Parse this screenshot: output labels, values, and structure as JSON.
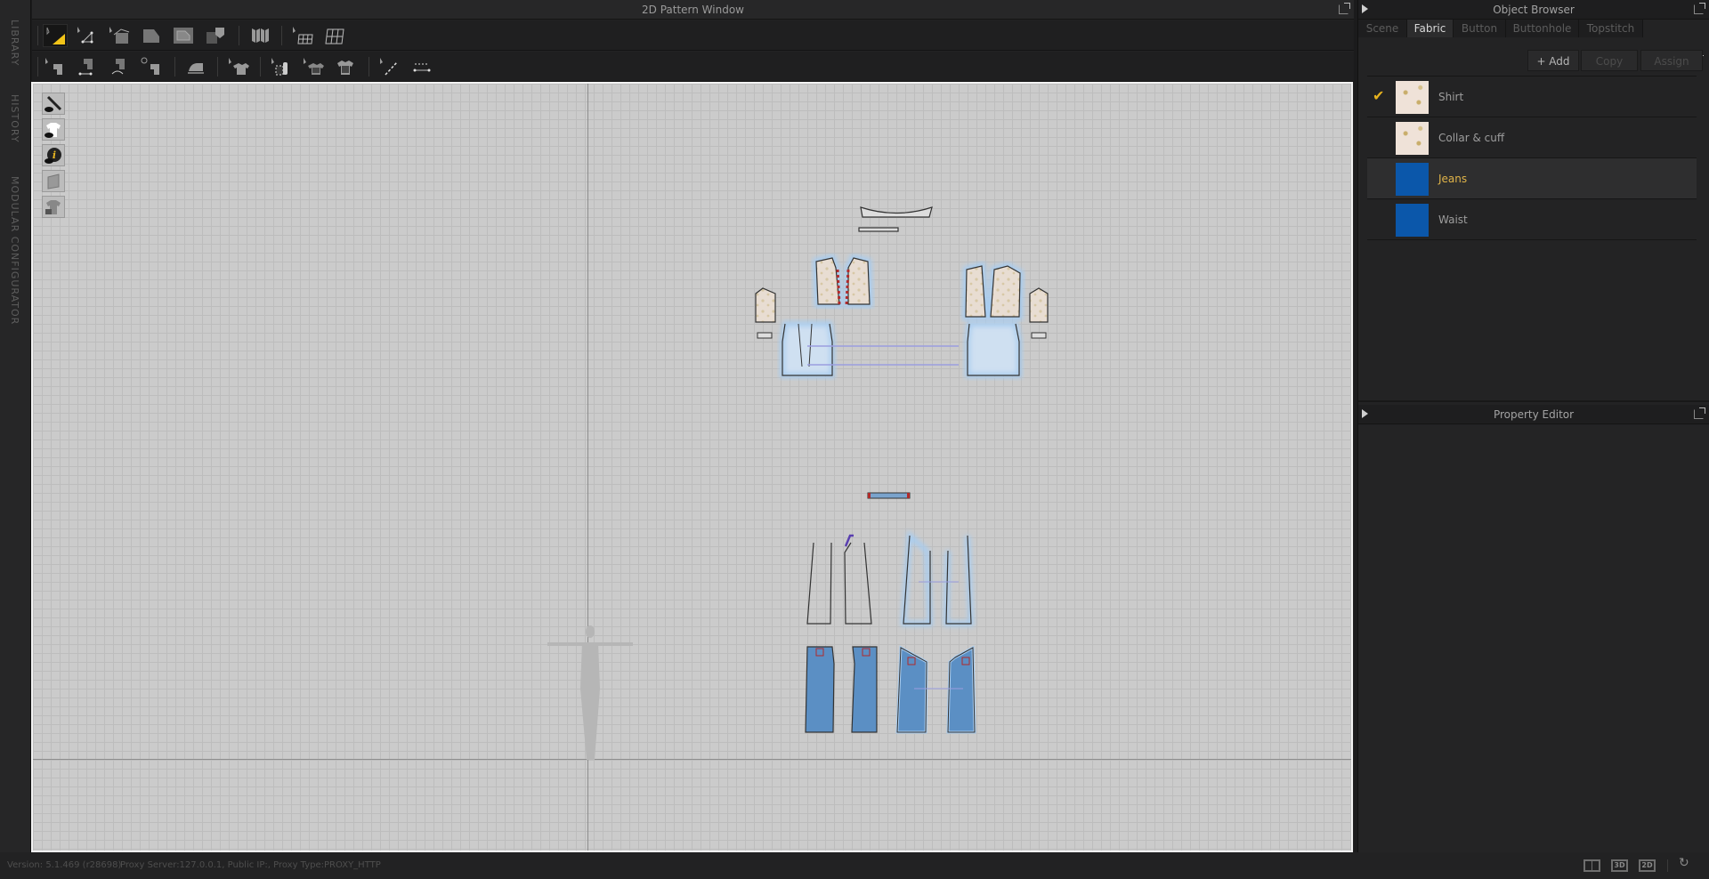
{
  "left_strip": {
    "tabs": [
      "LIBRARY",
      "HISTORY",
      "MODULAR CONFIGURATOR"
    ]
  },
  "pattern_window": {
    "title": "2D Pattern Window",
    "toolbar_row1": [
      {
        "icon": "transform-pattern-icon",
        "active": true
      },
      {
        "icon": "edit-point-line-icon"
      },
      {
        "icon": "edit-curvature-icon"
      },
      {
        "icon": "polygon-icon"
      },
      {
        "icon": "internal-polygon-icon"
      },
      {
        "icon": "trace-icon"
      },
      {
        "icon": "fold-arrangement-icon"
      },
      {
        "icon": "select-mesh-icon"
      },
      {
        "icon": "edit-mesh-icon"
      }
    ],
    "toolbar_row2": [
      {
        "icon": "edit-sewing-icon"
      },
      {
        "icon": "segment-sewing-icon"
      },
      {
        "icon": "free-sewing-icon"
      },
      {
        "icon": "check-sewing-length-icon"
      },
      {
        "icon": "tack-iron-icon"
      },
      {
        "icon": "select-garment-icon"
      },
      {
        "icon": "edit-texture-icon"
      },
      {
        "icon": "select-fabric-icon"
      },
      {
        "icon": "assign-fabric-icon"
      },
      {
        "icon": "edit-topstitch-icon"
      },
      {
        "icon": "segment-topstitch-icon"
      }
    ],
    "view_tools": [
      {
        "icon": "show-pattern-line-icon"
      },
      {
        "icon": "show-garment-icon"
      },
      {
        "icon": "show-pattern-info-icon"
      },
      {
        "icon": "show-fabric-texture-icon"
      },
      {
        "icon": "lock-pattern-icon"
      }
    ]
  },
  "object_browser": {
    "title": "Object Browser",
    "tabs": [
      {
        "label": "Scene",
        "active": false
      },
      {
        "label": "Fabric",
        "active": true
      },
      {
        "label": "Button",
        "active": false
      },
      {
        "label": "Buttonhole",
        "active": false
      },
      {
        "label": "Topstitch",
        "active": false
      }
    ],
    "buttons": {
      "add": "+ Add",
      "copy": "Copy",
      "assign": "Assign"
    },
    "fabrics": [
      {
        "name": "Shirt",
        "swatch": "print",
        "checked": true,
        "selected": false
      },
      {
        "name": "Collar & cuff",
        "swatch": "print",
        "checked": false,
        "selected": false
      },
      {
        "name": "Jeans",
        "swatch": "blue",
        "checked": false,
        "selected": true
      },
      {
        "name": "Waist",
        "swatch": "blue",
        "checked": false,
        "selected": false
      }
    ],
    "colors": {
      "checked": "#e6b21e",
      "selected_text": "#e0b449",
      "denim": "#0b57aa"
    }
  },
  "property_editor": {
    "title": "Property Editor"
  },
  "status_bar": {
    "version": "Version: 5.1.469 (r28698)",
    "proxy": "Proxy Server:127.0.0.1, Public IP:, Proxy Type:PROXY_HTTP",
    "view_buttons": [
      {
        "label": "",
        "icon": "split-view-icon"
      },
      {
        "label": "3D",
        "icon": "3d-view-icon"
      },
      {
        "label": "2D",
        "icon": "2d-view-icon"
      },
      {
        "label": "",
        "icon": "refresh-icon"
      }
    ]
  }
}
